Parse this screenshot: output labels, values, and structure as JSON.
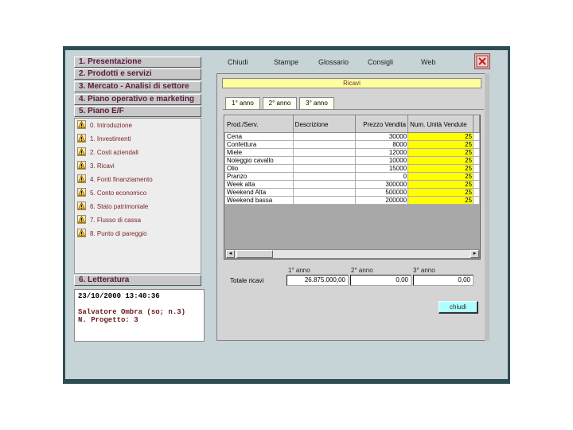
{
  "sidebar": {
    "sections": [
      {
        "label": "1. Presentazione"
      },
      {
        "label": "2. Prodotti e servizi"
      },
      {
        "label": "3. Mercato - Analisi di settore"
      },
      {
        "label": "4. Piano operativo e marketing"
      },
      {
        "label": "5. Piano E/F"
      }
    ],
    "subitems": [
      {
        "label": "0. Introduzione"
      },
      {
        "label": "1. Investimenti"
      },
      {
        "label": "2. Costi aziendali"
      },
      {
        "label": "3. Ricavi"
      },
      {
        "label": "4. Fonti finanziamento"
      },
      {
        "label": "5. Conto economico"
      },
      {
        "label": "6. Stato patrimoniale"
      },
      {
        "label": "7. Flusso di cassa"
      },
      {
        "label": "8. Punto di pareggio"
      }
    ],
    "section6": "6. Letteratura",
    "info": {
      "datetime": "23/10/2000 13:40:36",
      "user": "Salvatore Ombra (so; n.3)",
      "project": "N. Progetto: 3"
    }
  },
  "menu": {
    "items": [
      "Chiudi",
      "Stampe",
      "Glossario",
      "Consigli",
      "Web"
    ]
  },
  "panel": {
    "title": "Ricavi",
    "tabs": [
      "1° anno",
      "2° anno",
      "3° anno"
    ],
    "table": {
      "headers": [
        "Prod./Serv.",
        "Descrizione",
        "Prezzo Vendita",
        "Num. Unità Vendute"
      ],
      "rows": [
        {
          "prod": "Cena",
          "desc": "",
          "price": "30000",
          "units": "25"
        },
        {
          "prod": "Confettura",
          "desc": "",
          "price": "8000",
          "units": "25"
        },
        {
          "prod": "Miele",
          "desc": "",
          "price": "12000",
          "units": "25"
        },
        {
          "prod": "Noleggio cavallo",
          "desc": "",
          "price": "10000",
          "units": "25"
        },
        {
          "prod": "Olio",
          "desc": "",
          "price": "15000",
          "units": "25"
        },
        {
          "prod": "Pranzo",
          "desc": "",
          "price": "0",
          "units": "25"
        },
        {
          "prod": "Week alta",
          "desc": "",
          "price": "300000",
          "units": "25"
        },
        {
          "prod": "Weekend Alta",
          "desc": "",
          "price": "500000",
          "units": "25"
        },
        {
          "prod": "Weekend bassa",
          "desc": "",
          "price": "200000",
          "units": "25"
        }
      ]
    },
    "totals": {
      "label": "Totale ricavi",
      "years": [
        "1° anno",
        "2° anno",
        "3° anno"
      ],
      "values": [
        "26.875.000,00",
        "0,00",
        "0,00"
      ]
    },
    "close_label": "chiudi"
  },
  "colors": {
    "frame": "#2d4d55",
    "background": "#c6d3d7",
    "highlight": "#ffff00",
    "ribbon": "#ffffa0",
    "button": "#b0ffff"
  }
}
